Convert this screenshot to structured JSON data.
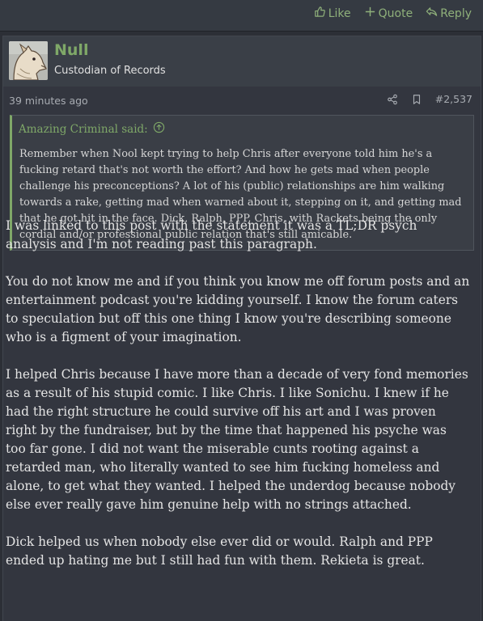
{
  "prev_post": {
    "actions": {
      "like": "Like",
      "quote": "Quote",
      "reply": "Reply"
    }
  },
  "post": {
    "username": "Null",
    "user_title": "Custodian of Records",
    "time": "39 minutes ago",
    "post_number": "#2,537",
    "quote": {
      "author": "Amazing Criminal said:",
      "text": "Remember when Nool kept trying to help Chris after everyone told him he's a fucking retard that's not worth the effort? And how he gets mad when people challenge his preconceptions? A lot of his (public) relationships are him walking towards a rake, getting mad when warned about it, stepping on it, and getting mad that he got hit in the face. Dick, Ralph, PPP, Chris, with Rackets being the only cordial and/or professional public relation that's still amicable."
    },
    "paragraphs": [
      "I was linked to this post with the statement it was a TL;DR psych analysis and I'm not reading past this paragraph.",
      "You do not know me and if you think you know me off forum posts and an entertainment podcast you're kidding yourself. I know the forum caters to speculation but off this one thing I know you're describing someone who is a figment of your imagination.",
      "I helped Chris because I have more than a decade of very fond memories as a result of his stupid comic. I like Chris. I like Sonichu. I knew if he had the right structure he could survive off his art and I was proven right by the fundraiser, but by the time that happened his psyche was too far gone. I did not want the miserable cunts rooting against a retarded man, who literally wanted to see him fucking homeless and alone, to get what they wanted. I helped the underdog because nobody else ever really gave him genuine help with no strings attached.",
      "Dick helped us when nobody else ever did or would. Ralph and PPP ended up hating me but I still had fun with them. Rekieta is great."
    ]
  },
  "colors": {
    "accent_green": "#7fa868",
    "background": "#2c2f36",
    "text": "#e4e4e4"
  },
  "icons": {
    "like": "thumbs-up-icon",
    "quote": "plus-icon",
    "reply": "reply-arrow-icon",
    "share": "share-icon",
    "bookmark": "bookmark-icon",
    "quote_jump": "circle-arrow-up-icon"
  }
}
